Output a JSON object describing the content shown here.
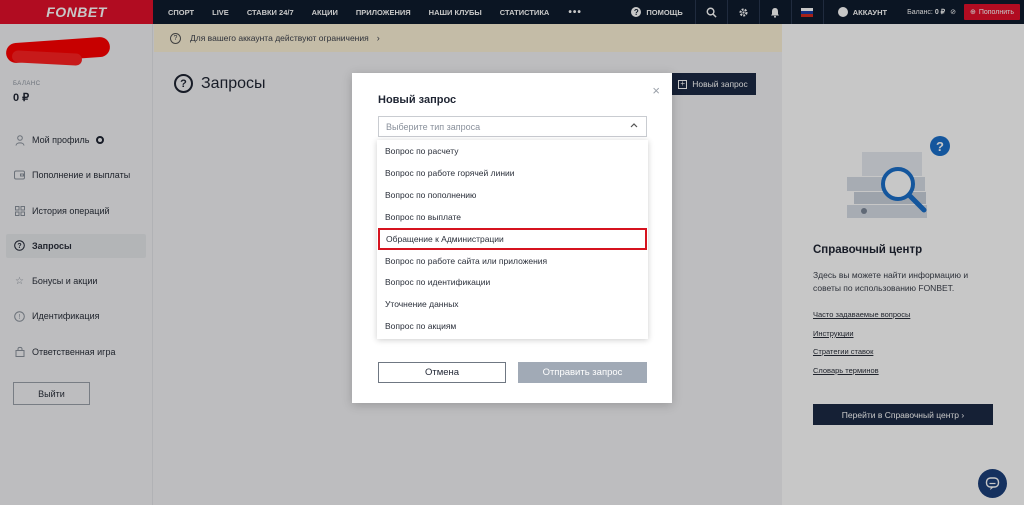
{
  "topbar": {
    "logo": "FONBET",
    "nav": [
      "СПОРТ",
      "LIVE",
      "СТАВКИ 24/7",
      "АКЦИИ",
      "ПРИЛОЖЕНИЯ",
      "НАШИ КЛУБЫ",
      "СТАТИСТИКА"
    ],
    "more": "•••",
    "help": "ПОМОЩЬ",
    "account": "АККАУНТ",
    "balance_label": "Баланс:",
    "balance_value": "0 ₽",
    "deposit": "Пополнить"
  },
  "sidebar": {
    "balance_label": "БАЛАНС",
    "balance_value": "0 ₽",
    "items": [
      {
        "label": "Мой профиль",
        "icon": "user-icon"
      },
      {
        "label": "Пополнение и выплаты",
        "icon": "wallet-icon"
      },
      {
        "label": "История операций",
        "icon": "grid-icon"
      },
      {
        "label": "Запросы",
        "icon": "question-icon"
      },
      {
        "label": "Бонусы и акции",
        "icon": "star-icon"
      },
      {
        "label": "Идентификация",
        "icon": "info-icon"
      },
      {
        "label": "Ответственная игра",
        "icon": "lock-icon"
      }
    ],
    "logout": "Выйти"
  },
  "warning": {
    "text": "Для вашего аккаунта действуют ограничения",
    "arrow": "›"
  },
  "main": {
    "title": "Запросы",
    "new_request": "Новый запрос"
  },
  "help_center": {
    "title": "Справочный центр",
    "desc": "Здесь вы можете найти информацию и советы по использованию FONBET.",
    "links": [
      "Часто задаваемые вопросы",
      "Инструкции",
      "Стратегии ставок",
      "Словарь терминов"
    ],
    "button": "Перейти в Справочный центр  ›"
  },
  "modal": {
    "title": "Новый запрос",
    "close": "×",
    "select_placeholder": "Выберите тип запроса",
    "options": [
      "Вопрос по расчету",
      "Вопрос по работе горячей линии",
      "Вопрос по пополнению",
      "Вопрос по выплате",
      "Обращение к Администрации",
      "Вопрос по работе сайта или приложения",
      "Вопрос по идентификации",
      "Уточнение данных",
      "Вопрос по акциям"
    ],
    "highlighted_index": 4,
    "cancel": "Отмена",
    "submit": "Отправить запрос"
  },
  "colors": {
    "brand_red": "#e3102b",
    "nav_dark": "#0f1c2e",
    "button_navy": "#1c2a45",
    "highlight_border": "#d6131f"
  }
}
